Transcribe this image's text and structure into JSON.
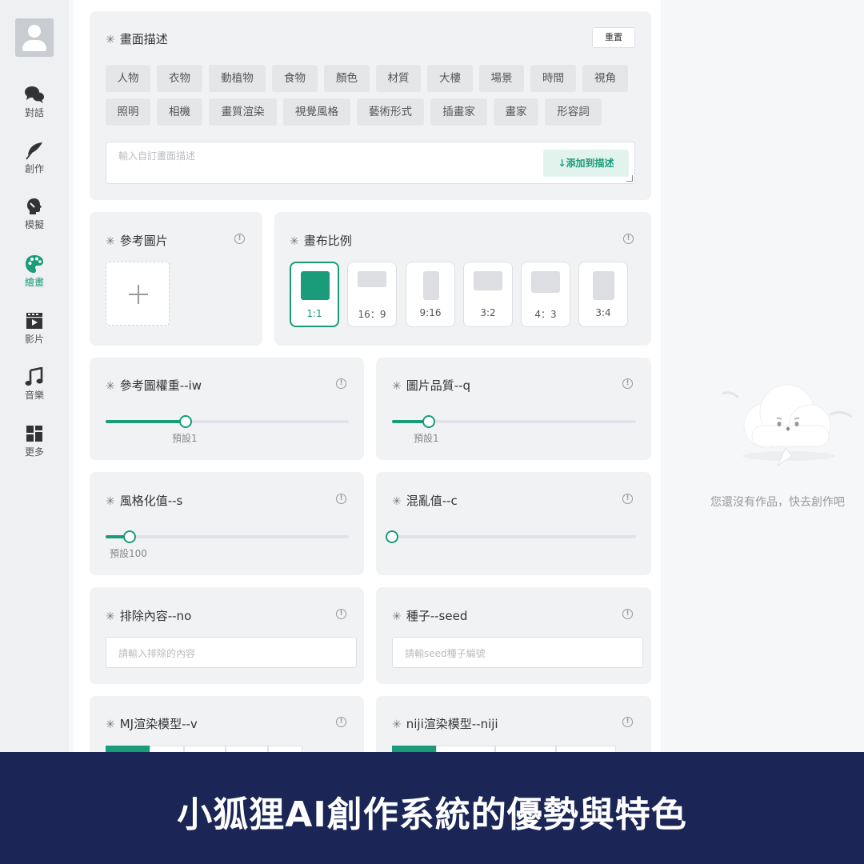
{
  "sidebar": {
    "items": [
      {
        "label": "對話",
        "icon": "chat-bubbles-icon"
      },
      {
        "label": "創作",
        "icon": "feather-icon"
      },
      {
        "label": "模擬",
        "icon": "head-silhouette-icon"
      },
      {
        "label": "繪畫",
        "icon": "palette-icon",
        "active": true
      },
      {
        "label": "影片",
        "icon": "video-film-icon"
      },
      {
        "label": "音樂",
        "icon": "music-note-icon"
      },
      {
        "label": "更多",
        "icon": "grid-more-icon"
      }
    ]
  },
  "description": {
    "title": "畫面描述",
    "reset_label": "重置",
    "tags_row1": [
      "人物",
      "衣物",
      "動植物",
      "食物",
      "顏色",
      "材質",
      "大樓",
      "場景",
      "時間",
      "視角"
    ],
    "tags_row2": [
      "照明",
      "相機",
      "畫質渲染",
      "視覺風格",
      "藝術形式",
      "插畫家",
      "畫家",
      "形容詞"
    ],
    "input_placeholder": "輸入自訂畫面描述",
    "add_label": "↓添加到描述"
  },
  "reference_image": {
    "title": "參考圖片"
  },
  "canvas_ratio": {
    "title": "畫布比例",
    "options": [
      "1:1",
      "16：9",
      "9:16",
      "3:2",
      "4：3",
      "3:4"
    ],
    "selected": "1:1"
  },
  "sliders": {
    "iw": {
      "title": "參考圖權重--iw",
      "note": "預設1",
      "value_fraction": 0.33
    },
    "q": {
      "title": "圖片品質--q",
      "note": "預設1",
      "value_fraction": 0.15
    },
    "s": {
      "title": "風格化值--s",
      "note": "預設100",
      "value_fraction": 0.1
    },
    "c": {
      "title": "混亂值--c",
      "note": "",
      "value_fraction": 0.0
    }
  },
  "exclude": {
    "title": "排除內容--no",
    "placeholder": "請輸入排除的內容"
  },
  "seed": {
    "title": "種子--seed",
    "placeholder": "請輸seed種子編號"
  },
  "mj_model": {
    "title": "MJ渲染模型--v"
  },
  "niji_model": {
    "title": "niji渲染模型--niji"
  },
  "right_panel": {
    "empty_text": "您還沒有作品，快去創作吧"
  },
  "banner": {
    "title": "小狐狸AI創作系統的優勢與特色"
  },
  "colors": {
    "accent": "#1a9b7a",
    "banner_bg": "#1b2657"
  }
}
